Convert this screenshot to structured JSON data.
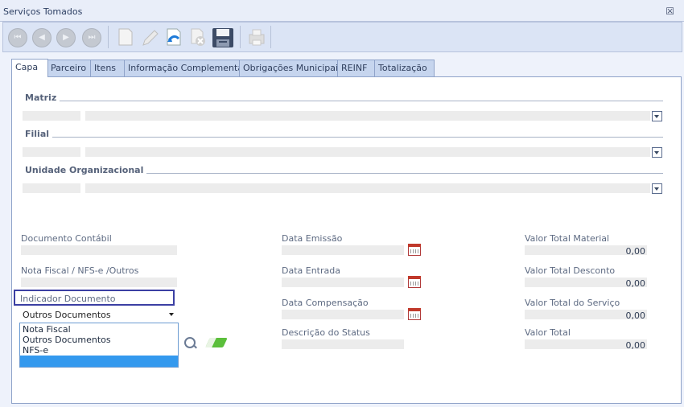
{
  "window": {
    "title": "Serviços Tomados"
  },
  "toolbar": {
    "nav_icons": [
      "first-record-icon",
      "previous-record-icon",
      "next-record-icon",
      "last-record-icon"
    ],
    "action_icons": [
      "new-document-icon",
      "edit-icon",
      "undo-icon",
      "delete-icon",
      "save-icon",
      "print-icon"
    ]
  },
  "tabs": [
    {
      "label": "Capa",
      "active": true
    },
    {
      "label": "Parceiro"
    },
    {
      "label": "Itens"
    },
    {
      "label": "Informação Complementar"
    },
    {
      "label": "Obrigações Municipais"
    },
    {
      "label": "REINF"
    },
    {
      "label": "Totalização"
    }
  ],
  "sections": {
    "matriz": "Matriz",
    "filial": "Filial",
    "unidade": "Unidade Organizacional"
  },
  "fields": {
    "documento_contabil": "Documento Contábil",
    "nota_fiscal": "Nota Fiscal / NFS-e /Outros",
    "indicador_documento": "Indicador Documento",
    "indicador_value": "Outros Documentos",
    "data_emissao": "Data Emissão",
    "data_entrada": "Data Entrada",
    "data_compensacao": "Data Compensação",
    "descricao_status": "Descrição do Status",
    "valor_total_material": "Valor Total Material",
    "valor_total_desconto": "Valor Total Desconto",
    "valor_total_servico": "Valor Total do Serviço",
    "valor_total": "Valor Total"
  },
  "values": {
    "material": "0,00",
    "desconto": "0,00",
    "servico": "0,00",
    "total": "0,00"
  },
  "dropdown": {
    "options": [
      "Nota Fiscal",
      "Outros Documentos",
      "NFS-e"
    ]
  },
  "colors": {
    "accent": "#3b3fa3",
    "selection": "#3399ee",
    "tab_bg": "#c6d5ee"
  }
}
